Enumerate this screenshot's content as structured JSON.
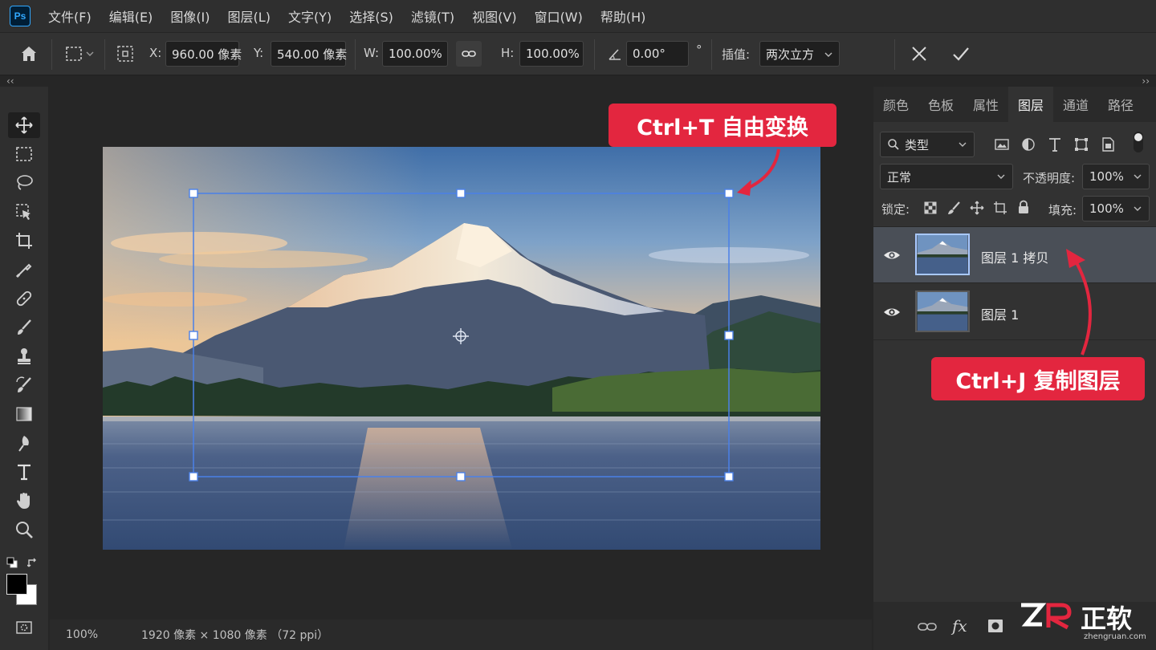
{
  "app": {
    "logo": "Ps"
  },
  "menu": [
    "文件(F)",
    "编辑(E)",
    "图像(I)",
    "图层(L)",
    "文字(Y)",
    "选择(S)",
    "滤镜(T)",
    "视图(V)",
    "窗口(W)",
    "帮助(H)"
  ],
  "options": {
    "x_label": "X:",
    "x_value": "960.00 像素",
    "y_label": "Y:",
    "y_value": "540.00 像素",
    "w_label": "W:",
    "w_value": "100.00%",
    "h_label": "H:",
    "h_value": "100.00%",
    "angle_value": "0.00°",
    "degree_mark": "°",
    "interp_label": "插值:",
    "interp_value": "两次立方"
  },
  "panel": {
    "tabs": [
      "颜色",
      "色板",
      "属性",
      "图层",
      "通道",
      "路径"
    ],
    "active_tab": "图层",
    "filter_label": "类型",
    "blend_mode": "正常",
    "opacity_label": "不透明度:",
    "opacity_value": "100%",
    "lock_label": "锁定:",
    "fill_label": "填充:",
    "fill_value": "100%",
    "layers": [
      {
        "name": "图层 1 拷贝",
        "selected": true
      },
      {
        "name": "图层 1",
        "selected": false
      }
    ],
    "footer_fx": "fx"
  },
  "status": {
    "zoom": "100%",
    "doc_info": "1920 像素 × 1080 像素 （72 ppi）"
  },
  "callouts": {
    "transform": "Ctrl+T  自由变换",
    "duplicate": "Ctrl+J  复制图层"
  },
  "watermark": {
    "brand": "正软",
    "url": "zhengruan.com"
  },
  "colors": {
    "accent": "#e3263f",
    "selection": "#4a80e8",
    "ps_blue": "#31a8ff"
  }
}
